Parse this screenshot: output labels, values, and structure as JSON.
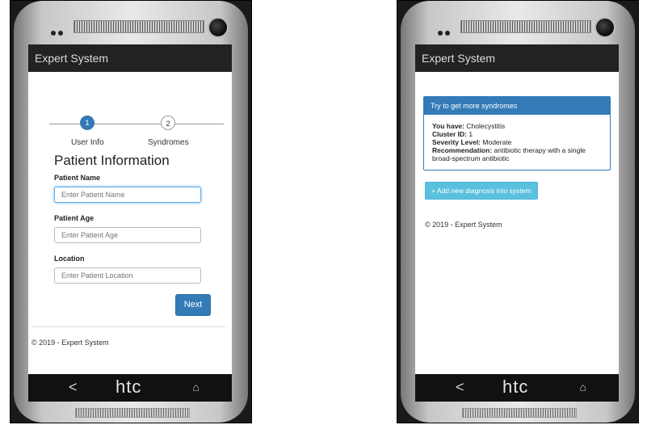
{
  "left_phone": {
    "app_title": "Expert System",
    "stepper": {
      "steps": [
        {
          "number": "1",
          "label": "User Info"
        },
        {
          "number": "2",
          "label": "Syndromes"
        }
      ]
    },
    "form": {
      "heading": "Patient Information",
      "fields": [
        {
          "label": "Patient Name",
          "placeholder": "Enter Patient Name"
        },
        {
          "label": "Patient Age",
          "placeholder": "Enter Patient Age"
        },
        {
          "label": "Location",
          "placeholder": "Enter Patient Location"
        }
      ],
      "next_label": "Next"
    },
    "footer": "© 2019 - Expert System",
    "nav": {
      "back": "<",
      "brand": "htc",
      "home": "⌂"
    }
  },
  "right_phone": {
    "app_title": "Expert System",
    "panel": {
      "heading": "Try to get more syndromes",
      "rows": [
        {
          "key": "You have:",
          "value": "Cholecystitis"
        },
        {
          "key": "Cluster ID:",
          "value": "1"
        },
        {
          "key": "Severity Level:",
          "value": "Moderate"
        },
        {
          "key": "Recommendation:",
          "value": "antibiotic therapy with a single broad-spectrum antibiotic"
        }
      ]
    },
    "add_button": "+ Add new diagnosis into system",
    "footer": "© 2019 - Expert System",
    "nav": {
      "back": "<",
      "brand": "htc",
      "home": "⌂"
    }
  },
  "colors": {
    "primary": "#337ab7",
    "info": "#5bc0de",
    "appbar": "#222222"
  }
}
